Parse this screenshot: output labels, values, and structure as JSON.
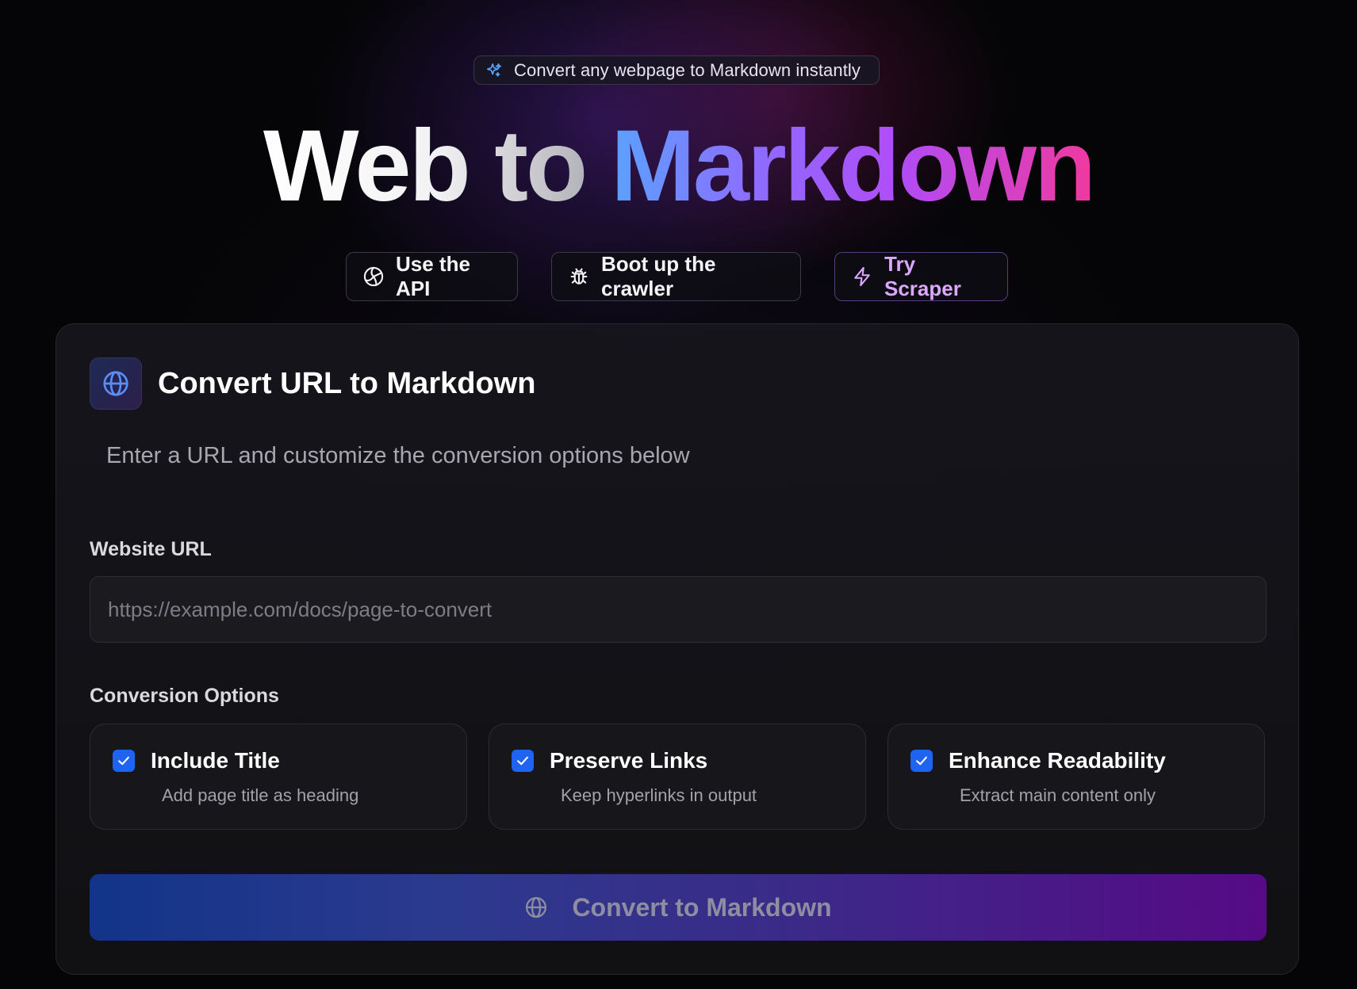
{
  "badge": {
    "text": "Convert any webpage to Markdown instantly",
    "icon": "sparkles-icon"
  },
  "hero": {
    "title_plain": "Web to",
    "title_gradient": "Markdown"
  },
  "hero_buttons": [
    {
      "label": "Use the API",
      "icon": "api-icon"
    },
    {
      "label": "Boot up the crawler",
      "icon": "bug-icon"
    },
    {
      "label": "Try Scraper",
      "icon": "zap-icon"
    }
  ],
  "card": {
    "title": "Convert URL to Markdown",
    "icon": "globe-icon",
    "description": "Enter a URL and customize the conversion options below"
  },
  "url_field": {
    "label": "Website URL",
    "value": "",
    "placeholder": "https://example.com/docs/page-to-convert"
  },
  "options": {
    "label": "Conversion Options",
    "items": [
      {
        "title": "Include Title",
        "description": "Add page title as heading",
        "checked": true
      },
      {
        "title": "Preserve Links",
        "description": "Keep hyperlinks in output",
        "checked": true
      },
      {
        "title": "Enhance Readability",
        "description": "Extract main content only",
        "checked": true
      }
    ]
  },
  "convert_button": {
    "label": "Convert to Markdown",
    "icon": "globe-icon"
  },
  "colors": {
    "accent_blue": "#1f63f2",
    "gradient_start": "#5aa2ff",
    "gradient_mid": "#b14cf6",
    "gradient_end": "#f0399e",
    "scraper_accent": "#dba7ff"
  }
}
